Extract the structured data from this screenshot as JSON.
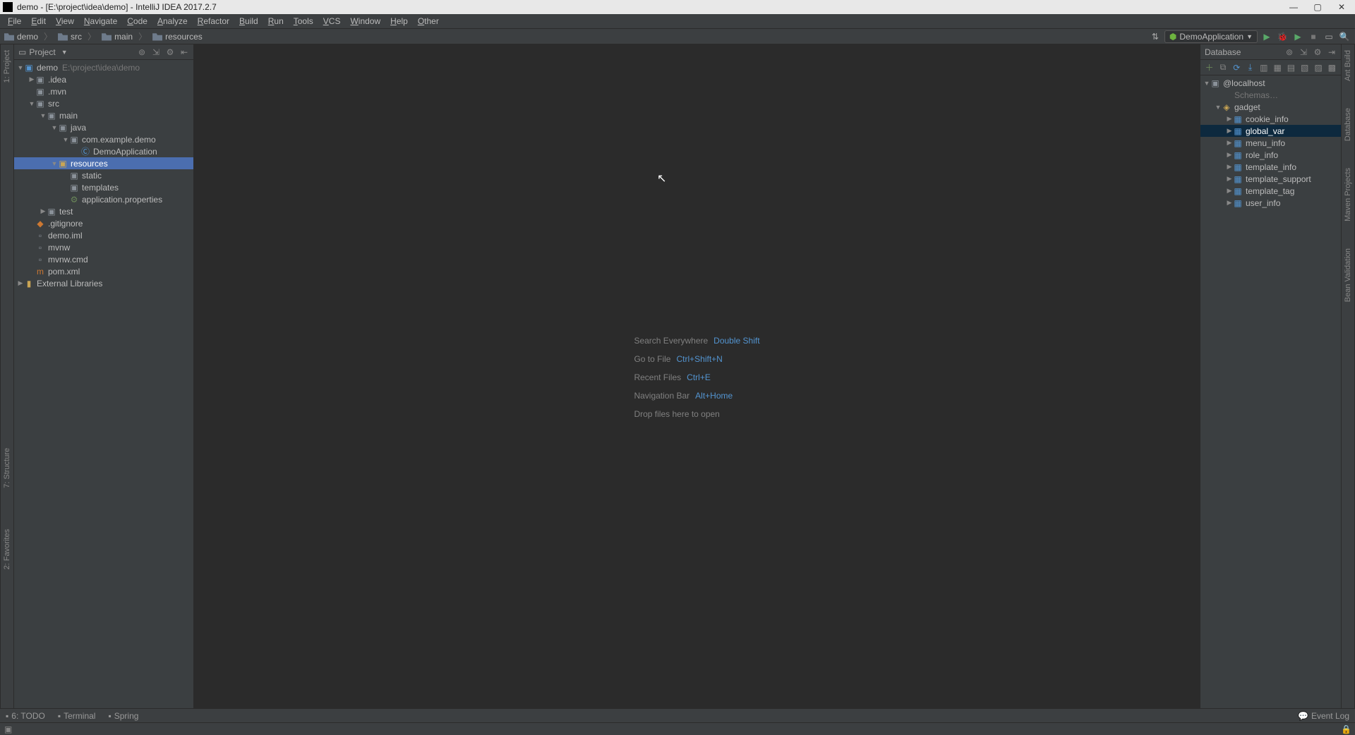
{
  "title": "demo - [E:\\project\\idea\\demo] - IntelliJ IDEA 2017.2.7",
  "menubar": [
    "File",
    "Edit",
    "View",
    "Navigate",
    "Code",
    "Analyze",
    "Refactor",
    "Build",
    "Run",
    "Tools",
    "VCS",
    "Window",
    "Help",
    "Other"
  ],
  "breadcrumbs": [
    {
      "label": "demo",
      "icon": "folder"
    },
    {
      "label": "src",
      "icon": "folder"
    },
    {
      "label": "main",
      "icon": "folder"
    },
    {
      "label": "resources",
      "icon": "folder"
    }
  ],
  "run_config": "DemoApplication",
  "project_panel": {
    "title": "Project",
    "tree": [
      {
        "indent": 0,
        "arrow": "open",
        "icon": "module",
        "label": "demo",
        "hint": "E:\\project\\idea\\demo"
      },
      {
        "indent": 1,
        "arrow": "closed",
        "icon": "folder",
        "label": ".idea"
      },
      {
        "indent": 1,
        "arrow": "none",
        "icon": "folder",
        "label": ".mvn"
      },
      {
        "indent": 1,
        "arrow": "open",
        "icon": "folder",
        "label": "src"
      },
      {
        "indent": 2,
        "arrow": "open",
        "icon": "folder",
        "label": "main"
      },
      {
        "indent": 3,
        "arrow": "open",
        "icon": "folder",
        "label": "java"
      },
      {
        "indent": 4,
        "arrow": "open",
        "icon": "package",
        "label": "com.example.demo"
      },
      {
        "indent": 5,
        "arrow": "none",
        "icon": "class",
        "label": "DemoApplication"
      },
      {
        "indent": 3,
        "arrow": "open",
        "icon": "resources",
        "label": "resources",
        "selected": true
      },
      {
        "indent": 4,
        "arrow": "none",
        "icon": "folder",
        "label": "static"
      },
      {
        "indent": 4,
        "arrow": "none",
        "icon": "folder",
        "label": "templates"
      },
      {
        "indent": 4,
        "arrow": "none",
        "icon": "props",
        "label": "application.properties"
      },
      {
        "indent": 2,
        "arrow": "closed",
        "icon": "folder",
        "label": "test"
      },
      {
        "indent": 1,
        "arrow": "none",
        "icon": "gitignore",
        "label": ".gitignore"
      },
      {
        "indent": 1,
        "arrow": "none",
        "icon": "file",
        "label": "demo.iml"
      },
      {
        "indent": 1,
        "arrow": "none",
        "icon": "file",
        "label": "mvnw"
      },
      {
        "indent": 1,
        "arrow": "none",
        "icon": "file",
        "label": "mvnw.cmd"
      },
      {
        "indent": 1,
        "arrow": "none",
        "icon": "maven",
        "label": "pom.xml"
      },
      {
        "indent": 0,
        "arrow": "closed",
        "icon": "lib",
        "label": "External Libraries"
      }
    ]
  },
  "welcome": [
    {
      "text": "Search Everywhere",
      "shortcut": "Double Shift"
    },
    {
      "text": "Go to File",
      "shortcut": "Ctrl+Shift+N"
    },
    {
      "text": "Recent Files",
      "shortcut": "Ctrl+E"
    },
    {
      "text": "Navigation Bar",
      "shortcut": "Alt+Home"
    },
    {
      "text": "Drop files here to open",
      "shortcut": ""
    }
  ],
  "db_panel": {
    "title": "Database",
    "tree": [
      {
        "indent": 0,
        "arrow": "open",
        "icon": "datasource",
        "label": "@localhost"
      },
      {
        "indent": 1,
        "arrow": "none",
        "icon": "text",
        "label": "Schemas…",
        "dim": true
      },
      {
        "indent": 1,
        "arrow": "open",
        "icon": "schema",
        "label": "gadget"
      },
      {
        "indent": 2,
        "arrow": "closed",
        "icon": "table",
        "label": "cookie_info"
      },
      {
        "indent": 2,
        "arrow": "closed",
        "icon": "table",
        "label": "global_var",
        "selected": true
      },
      {
        "indent": 2,
        "arrow": "closed",
        "icon": "table",
        "label": "menu_info"
      },
      {
        "indent": 2,
        "arrow": "closed",
        "icon": "table",
        "label": "role_info"
      },
      {
        "indent": 2,
        "arrow": "closed",
        "icon": "table",
        "label": "template_info"
      },
      {
        "indent": 2,
        "arrow": "closed",
        "icon": "table",
        "label": "template_support"
      },
      {
        "indent": 2,
        "arrow": "closed",
        "icon": "table",
        "label": "template_tag"
      },
      {
        "indent": 2,
        "arrow": "closed",
        "icon": "table",
        "label": "user_info"
      }
    ]
  },
  "bottom_tabs_left": [
    {
      "label": "6: TODO",
      "icon": "todo"
    },
    {
      "label": "Terminal",
      "icon": "terminal"
    },
    {
      "label": "Spring",
      "icon": "spring"
    }
  ],
  "bottom_tabs_right": [
    {
      "label": "Event Log",
      "icon": "eventlog"
    }
  ],
  "left_gutter": [
    {
      "label": "1: Project"
    },
    {
      "label": "7: Structure"
    },
    {
      "label": "2: Favorites"
    }
  ],
  "right_gutter": [
    {
      "label": "Ant Build"
    },
    {
      "label": "Database"
    },
    {
      "label": "Maven Projects"
    },
    {
      "label": "Bean Validation"
    }
  ]
}
